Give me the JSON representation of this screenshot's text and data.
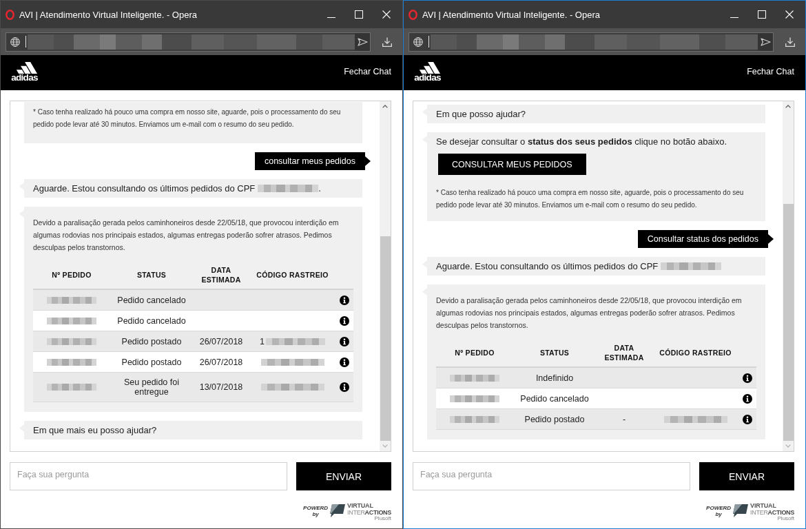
{
  "windows": [
    {
      "active": false,
      "title": "AVI | Atendimento Virtual Inteligente. - Opera",
      "address_bar": {
        "url_redacted": true
      },
      "header": {
        "logo_text": "adidas",
        "close_link": "Fechar Chat"
      },
      "messages": [
        {
          "kind": "bot",
          "cut_off": true,
          "note": "* Caso tenha realizado há pouco uma compra em nosso site, aguarde, pois o processamento do seu pedido pode levar até 30 minutos. Enviamos um e-mail com o resumo do seu pedido."
        },
        {
          "kind": "user",
          "text": "consultar meus pedidos"
        },
        {
          "kind": "bot",
          "cut_off": false,
          "text": "Aguarde. Estou consultando os últimos pedidos do CPF",
          "cpf_redacted": true,
          "text_after": "."
        },
        {
          "kind": "bot",
          "cut_off": false,
          "notice": "Devido a paralisação gerada pelos caminhoneiros desde 22/05/18, que provocou interdição em algumas rodovias nos principais estados, algumas entregas poderão sofrer atrasos. Pedimos desculpas pelos transtornos.",
          "table": {
            "columns": [
              "Nº PEDIDO",
              "STATUS",
              "DATA ESTIMADA",
              "CÓDIGO RASTREIO"
            ],
            "rows": [
              {
                "order_redacted": true,
                "status": "Pedido cancelado",
                "tracking_redacted": false
              },
              {
                "order_redacted": true,
                "status": "Pedido cancelado",
                "tracking_redacted": false
              },
              {
                "order_redacted": true,
                "status": "Pedido postado",
                "date": "26/07/2018",
                "tracking_prefix": "1",
                "tracking_redacted": true
              },
              {
                "order_redacted": true,
                "status": "Pedido postado",
                "date": "26/07/2018",
                "tracking_redacted": true
              },
              {
                "order_redacted": true,
                "status": "Seu pedido foi entregue",
                "date": "13/07/2018",
                "tracking_redacted": true
              }
            ]
          }
        },
        {
          "kind": "bot",
          "cut_off": false,
          "text": "Em que mais eu posso ajudar?"
        }
      ],
      "input": {
        "placeholder": "Faça sua pergunta"
      },
      "send_button": "ENVIAR",
      "footer": {
        "powered_label": "POWERD",
        "by_label": "by",
        "brand_line_1": "VIRTUAL",
        "brand_line_2": "INTER**ACTIONS**",
        "brand_sub": "Plusoft"
      }
    },
    {
      "active": true,
      "title": "AVI | Atendimento Virtual Inteligente. - Opera",
      "address_bar": {
        "url_redacted": true
      },
      "header": {
        "logo_text": "adidas",
        "close_link": "Fechar Chat"
      },
      "messages": [
        {
          "kind": "bot",
          "cut_off": false,
          "text": "Em que posso ajudar?"
        },
        {
          "kind": "bot",
          "cut_off": false,
          "text": "Se desejar consultar o **status dos seus pedidos** clique no botão abaixo.",
          "button": "CONSULTAR MEUS PEDIDOS",
          "note": "* Caso tenha realizado há pouco uma compra em nosso site, aguarde, pois o processamento do seu pedido pode levar até 30 minutos. Enviamos um e-mail com o resumo do seu pedido."
        },
        {
          "kind": "user",
          "text": "Consultar status dos pedidos"
        },
        {
          "kind": "bot",
          "cut_off": false,
          "text": "Aguarde. Estou consultando os últimos pedidos do CPF",
          "cpf_redacted": true
        },
        {
          "kind": "bot",
          "cut_off": false,
          "notice": "Devido a paralisação gerada pelos caminhoneiros desde 22/05/18, que provocou interdição em algumas rodovias nos principais estados, algumas entregas poderão sofrer atrasos. Pedimos desculpas pelos transtornos.",
          "table": {
            "columns": [
              "Nº PEDIDO",
              "STATUS",
              "DATA ESTIMADA",
              "CÓDIGO RASTREIO"
            ],
            "rows": [
              {
                "order_redacted": true,
                "status": "Indefinido",
                "tracking_redacted": false
              },
              {
                "order_redacted": true,
                "status": "Pedido cancelado",
                "tracking_redacted": false
              },
              {
                "order_redacted": true,
                "status": "Pedido postado",
                "date": "-",
                "tracking_redacted": true
              }
            ]
          }
        }
      ],
      "input": {
        "placeholder": "Faça sua pergunta"
      },
      "send_button": "ENVIAR",
      "footer": {
        "powered_label": "POWERD",
        "by_label": "by",
        "brand_line_1": "VIRTUAL",
        "brand_line_2": "INTER**ACTIONS**",
        "brand_sub": "Plusoft"
      }
    }
  ]
}
